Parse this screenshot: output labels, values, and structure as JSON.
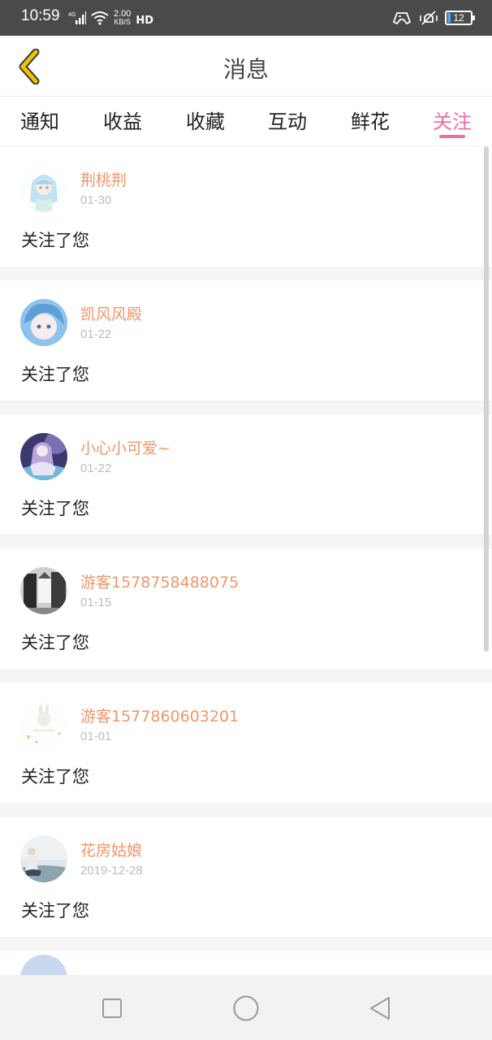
{
  "status_bar": {
    "time": "10:59",
    "network": "4G",
    "speed_value": "2.00",
    "speed_unit": "KB/S",
    "hd": "HD",
    "battery": "12"
  },
  "header": {
    "title": "消息",
    "back_icon": "chevron-left-icon"
  },
  "tabs": [
    {
      "label": "通知",
      "active": false
    },
    {
      "label": "收益",
      "active": false
    },
    {
      "label": "收藏",
      "active": false
    },
    {
      "label": "互动",
      "active": false
    },
    {
      "label": "鲜花",
      "active": false
    },
    {
      "label": "关注",
      "active": true
    }
  ],
  "messages": [
    {
      "name": "荆桃荆",
      "date": "01-30",
      "text": "关注了您"
    },
    {
      "name": "凯风风殿",
      "date": "01-22",
      "text": "关注了您"
    },
    {
      "name": "小心小可爱~",
      "date": "01-22",
      "text": "关注了您"
    },
    {
      "name": "游客1578758488075",
      "date": "01-15",
      "text": "关注了您"
    },
    {
      "name": "游客1577860603201",
      "date": "01-01",
      "text": "关注了您"
    },
    {
      "name": "花房姑娘",
      "date": "2019-12-28",
      "text": "关注了您"
    }
  ],
  "colors": {
    "accent": "#ef6ea0",
    "username": "#f0966a",
    "date": "#bdbdbd",
    "back_arrow": "#e0b000"
  },
  "navbar": [
    "square-recent-icon",
    "circle-home-icon",
    "triangle-back-icon"
  ]
}
